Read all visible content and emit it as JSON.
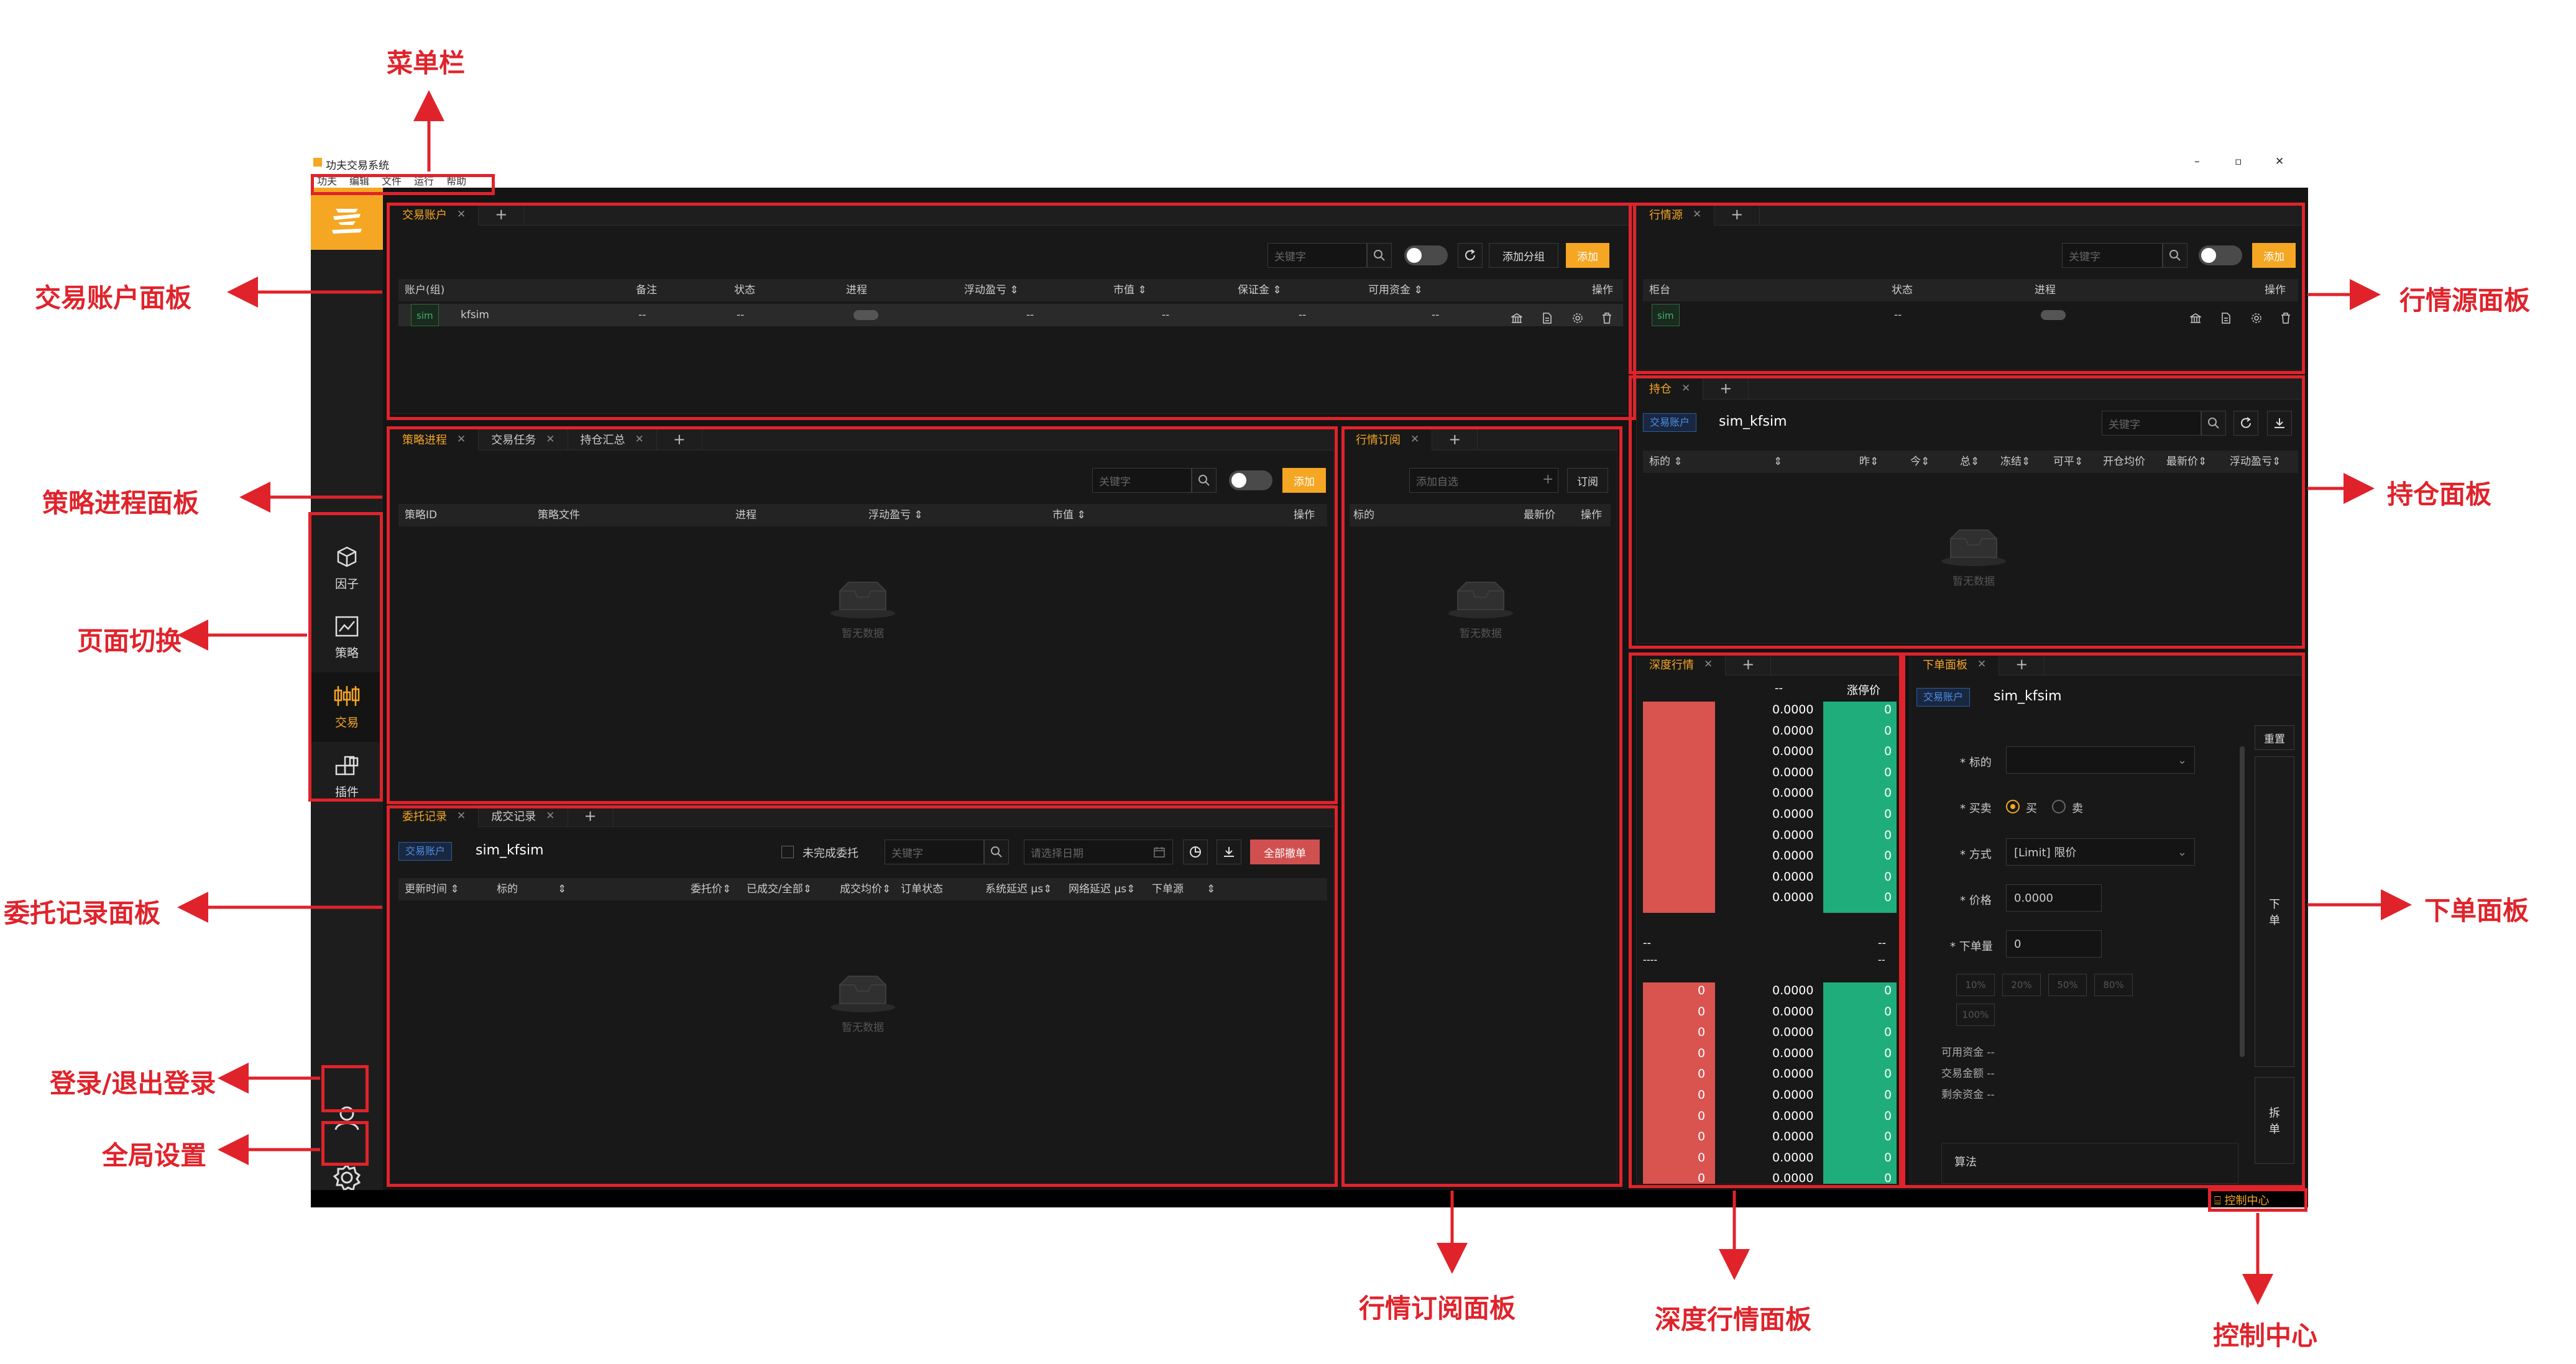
{
  "window": {
    "title": "功夫交易系统",
    "controls": [
      "–",
      "▫",
      "✕"
    ]
  },
  "menu": [
    "功夫",
    "编辑",
    "文件",
    "运行",
    "帮助"
  ],
  "nav": [
    {
      "label": "因子",
      "icon": "cube-icon"
    },
    {
      "label": "策略",
      "icon": "chart-icon"
    },
    {
      "label": "交易",
      "icon": "candlestick-icon"
    },
    {
      "label": "插件",
      "icon": "plugin-icon"
    }
  ],
  "colors": {
    "accent": "#f5a623",
    "bid": "#d9534f",
    "ask": "#1fae7b",
    "annotation": "#e0232b"
  },
  "account_panel": {
    "tab": "交易账户",
    "search_placeholder": "关键字",
    "add_group": "添加分组",
    "add": "添加",
    "columns": [
      "账户(组)",
      "备注",
      "状态",
      "进程",
      "浮动盈亏 ⇕",
      "市值 ⇕",
      "保证金 ⇕",
      "可用资金 ⇕",
      "操作"
    ],
    "row": {
      "tag": "sim",
      "name": "kfsim",
      "note": "--",
      "status": "--",
      "pnl": "--",
      "mv": "--",
      "margin": "--",
      "avail": "--"
    }
  },
  "md_source_panel": {
    "tab": "行情源",
    "search_placeholder": "关键字",
    "add": "添加",
    "columns": [
      "柜台",
      "状态",
      "进程",
      "操作"
    ],
    "row": {
      "tag": "sim",
      "status": "--"
    }
  },
  "strategy_panel": {
    "tabs": [
      "策略进程",
      "交易任务",
      "持仓汇总"
    ],
    "search_placeholder": "关键字",
    "add": "添加",
    "columns": [
      "策略ID",
      "策略文件",
      "进程",
      "浮动盈亏 ⇕",
      "市值 ⇕",
      "操作"
    ],
    "empty": "暂无数据"
  },
  "sub_panel": {
    "tab": "行情订阅",
    "input_placeholder": "添加自选",
    "subscribe": "订阅",
    "columns": [
      "标的",
      "最新价",
      "操作"
    ],
    "empty": "暂无数据"
  },
  "position_panel": {
    "tab": "持仓",
    "account_tag": "交易账户",
    "account": "sim_kfsim",
    "search_placeholder": "关键字",
    "columns": [
      "标的 ⇕",
      "⇕",
      "昨⇕",
      "今⇕",
      "总⇕",
      "冻结⇕",
      "可平⇕",
      "开仓均价",
      "最新价⇕",
      "浮动盈亏⇕"
    ],
    "empty": "暂无数据"
  },
  "order_panel": {
    "tabs": [
      "委托记录",
      "成交记录"
    ],
    "account_tag": "交易账户",
    "account": "sim_kfsim",
    "unfinished": "未完成委托",
    "search_placeholder": "关键字",
    "date_placeholder": "请选择日期",
    "cancel_all": "全部撤单",
    "columns": [
      "更新时间 ⇕",
      "标的",
      "⇕",
      "委托价⇕",
      "已成交/全部⇕",
      "成交均价⇕",
      "订单状态",
      "系统延迟 μs⇕",
      "网络延迟 μs⇕",
      "下单源",
      "⇕"
    ],
    "empty": "暂无数据"
  },
  "depth_panel": {
    "tab": "深度行情",
    "header_left": "--",
    "header_right": "涨停价",
    "price": "0.0000",
    "vol": "0",
    "mid_left": "--",
    "mid_left2": "----",
    "mid_right": "--",
    "mid_right2": "--"
  },
  "place_panel": {
    "tab": "下单面板",
    "account_tag": "交易账户",
    "account": "sim_kfsim",
    "reset": "重置",
    "instrument_label": "标的",
    "side_label": "买卖",
    "buy": "买",
    "sell": "卖",
    "type_label": "方式",
    "type_value": "[Limit] 限价",
    "price_label": "价格",
    "price_value": "0.0000",
    "vol_label": "下单量",
    "vol_value": "0",
    "pcts": [
      "10%",
      "20%",
      "50%",
      "80%",
      "100%"
    ],
    "avail": "可用资金 --",
    "amount": "交易金额 --",
    "remain": "剩余资金 --",
    "algo": "算法",
    "submit": "下\n单",
    "split": "拆\n单"
  },
  "statusbar": {
    "control_center": "控制中心"
  },
  "annotations": {
    "menubar": "菜单栏",
    "account": "交易账户面板",
    "strategy": "策略进程面板",
    "pages": "页面切换",
    "orders": "委托记录面板",
    "login": "登录/退出登录",
    "settings": "全局设置",
    "md_source": "行情源面板",
    "position": "持仓面板",
    "place": "下单面板",
    "sub": "行情订阅面板",
    "depth": "深度行情面板",
    "control": "控制中心"
  }
}
